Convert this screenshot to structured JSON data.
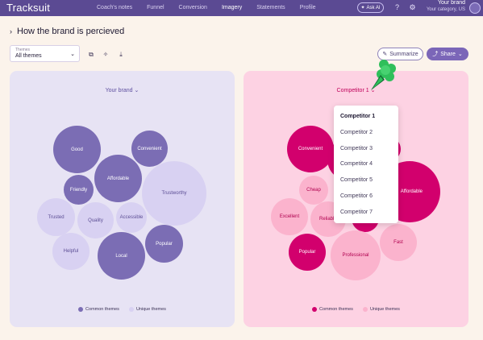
{
  "header": {
    "logo": "Tracksuit",
    "nav": [
      "Coach's notes",
      "Funnel",
      "Conversion",
      "Imagery",
      "Statements",
      "Profile"
    ],
    "active_nav": "Imagery",
    "ask_ai": "Ask AI",
    "brand_name": "Your brand",
    "brand_sub": "Your category, US"
  },
  "page": {
    "title": "How the brand is percieved"
  },
  "themes_select": {
    "label": "Themes",
    "value": "All themes"
  },
  "actions": {
    "summarize": "Summarize",
    "share": "Share"
  },
  "left_panel": {
    "header": "Your brand",
    "bubbles": [
      "Good",
      "Convenient",
      "Affordable",
      "Friendly",
      "Trustworthy",
      "Trusted",
      "Quality",
      "Accessible",
      "Helpful",
      "Local",
      "Popular"
    ],
    "legend": {
      "common": "Common themes",
      "unique": "Unique themes"
    }
  },
  "right_panel": {
    "header": "Competitor 1",
    "bubbles": [
      "Convenient",
      "Affordable",
      "Cheap",
      "Excellent",
      "Reliable",
      "Popular",
      "Professional",
      "Fast"
    ],
    "legend": {
      "common": "Common themes",
      "unique": "Unique themes"
    }
  },
  "dropdown": {
    "options": [
      "Competitor 1",
      "Competitor 2",
      "Competitor 3",
      "Competitor 4",
      "Competitor 5",
      "Competitor 6",
      "Competitor 7"
    ],
    "selected": "Competitor 1"
  },
  "colors": {
    "topbar": "#5b4a93",
    "left_common": "#7b6db4",
    "left_unique": "#d8d1f2",
    "right_common": "#d2006d",
    "right_unique": "#fbb3cd",
    "cursor": "#2fbf5b"
  },
  "icons": [
    "sparkle-icon",
    "help-icon",
    "settings-icon",
    "copy-icon",
    "magic-icon",
    "download-icon",
    "summarize-icon",
    "share-icon",
    "chevron-down-icon",
    "cursor-icon"
  ]
}
